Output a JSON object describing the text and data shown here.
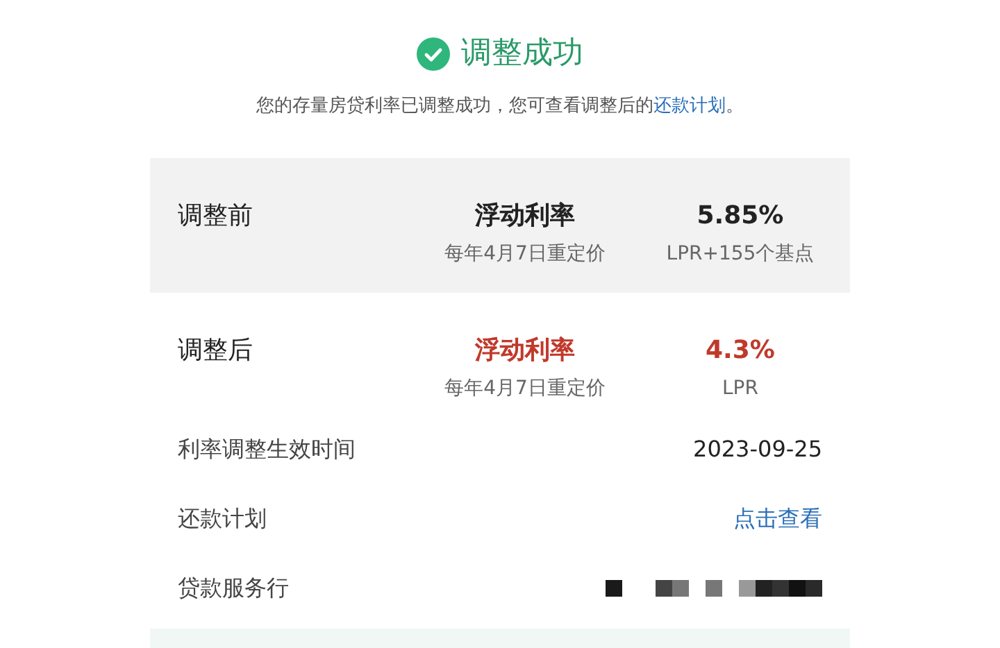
{
  "header": {
    "title": "调整成功",
    "message": "您的存量房贷利率已调整成功，您可查看调整后的",
    "link": "还款计划",
    "message_end": "。"
  },
  "comparison": [
    {
      "kind": "before",
      "label": "调整前",
      "rate_type": "浮动利率",
      "reprice": "每年4月7日重定价",
      "rate": "5.85%",
      "basis": "LPR+155个基点"
    },
    {
      "kind": "after",
      "label": "调整后",
      "rate_type": "浮动利率",
      "reprice": "每年4月7日重定价",
      "rate": "4.3%",
      "basis": "LPR"
    }
  ],
  "details": [
    {
      "kind": "text",
      "label": "利率调整生效时间",
      "value": "2023-09-25"
    },
    {
      "kind": "link",
      "label": "还款计划",
      "value": "点击查看"
    },
    {
      "kind": "redacted",
      "label": "贷款服务行"
    }
  ]
}
